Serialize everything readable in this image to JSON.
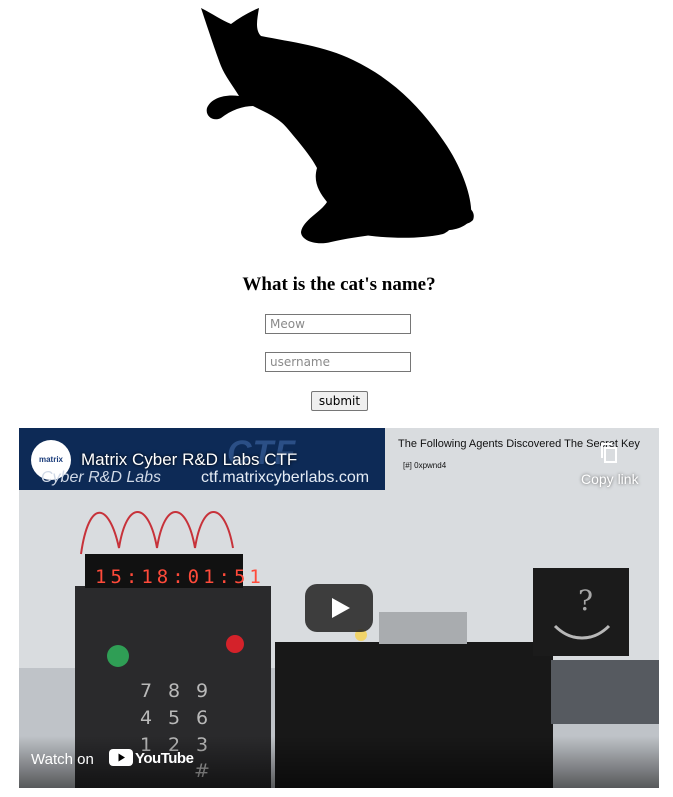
{
  "page": {
    "question": "What is the cat's name?",
    "name_field": {
      "placeholder": "Meow"
    },
    "username_field": {
      "placeholder": "username"
    },
    "submit_label": "submit"
  },
  "video": {
    "title": "Matrix Cyber R&D Labs CTF",
    "banner_logo": "matrix",
    "banner_mark": "CTF",
    "banner_subtitle": "Cyber R&D Labs",
    "banner_url": "ctf.matrixcyberlabs.com",
    "overlay_heading": "The Following Agents Discovered The Secret Key",
    "overlay_agent": "[#] 0xpwnd4",
    "copy_link_label": "Copy link",
    "watch_on_label": "Watch on",
    "youtube_label": "YouTube",
    "clock_display": "15:18:01:51",
    "keypad_keys": [
      "7",
      "8",
      "9",
      "4",
      "5",
      "6",
      "1",
      "2",
      "3",
      "",
      "",
      "#"
    ],
    "colors": {
      "banner": "#0d2a56",
      "play_button": "#212121",
      "clock_digits": "#ff4a3a",
      "led_green": "#2f9e55",
      "led_red": "#d4222a"
    }
  }
}
